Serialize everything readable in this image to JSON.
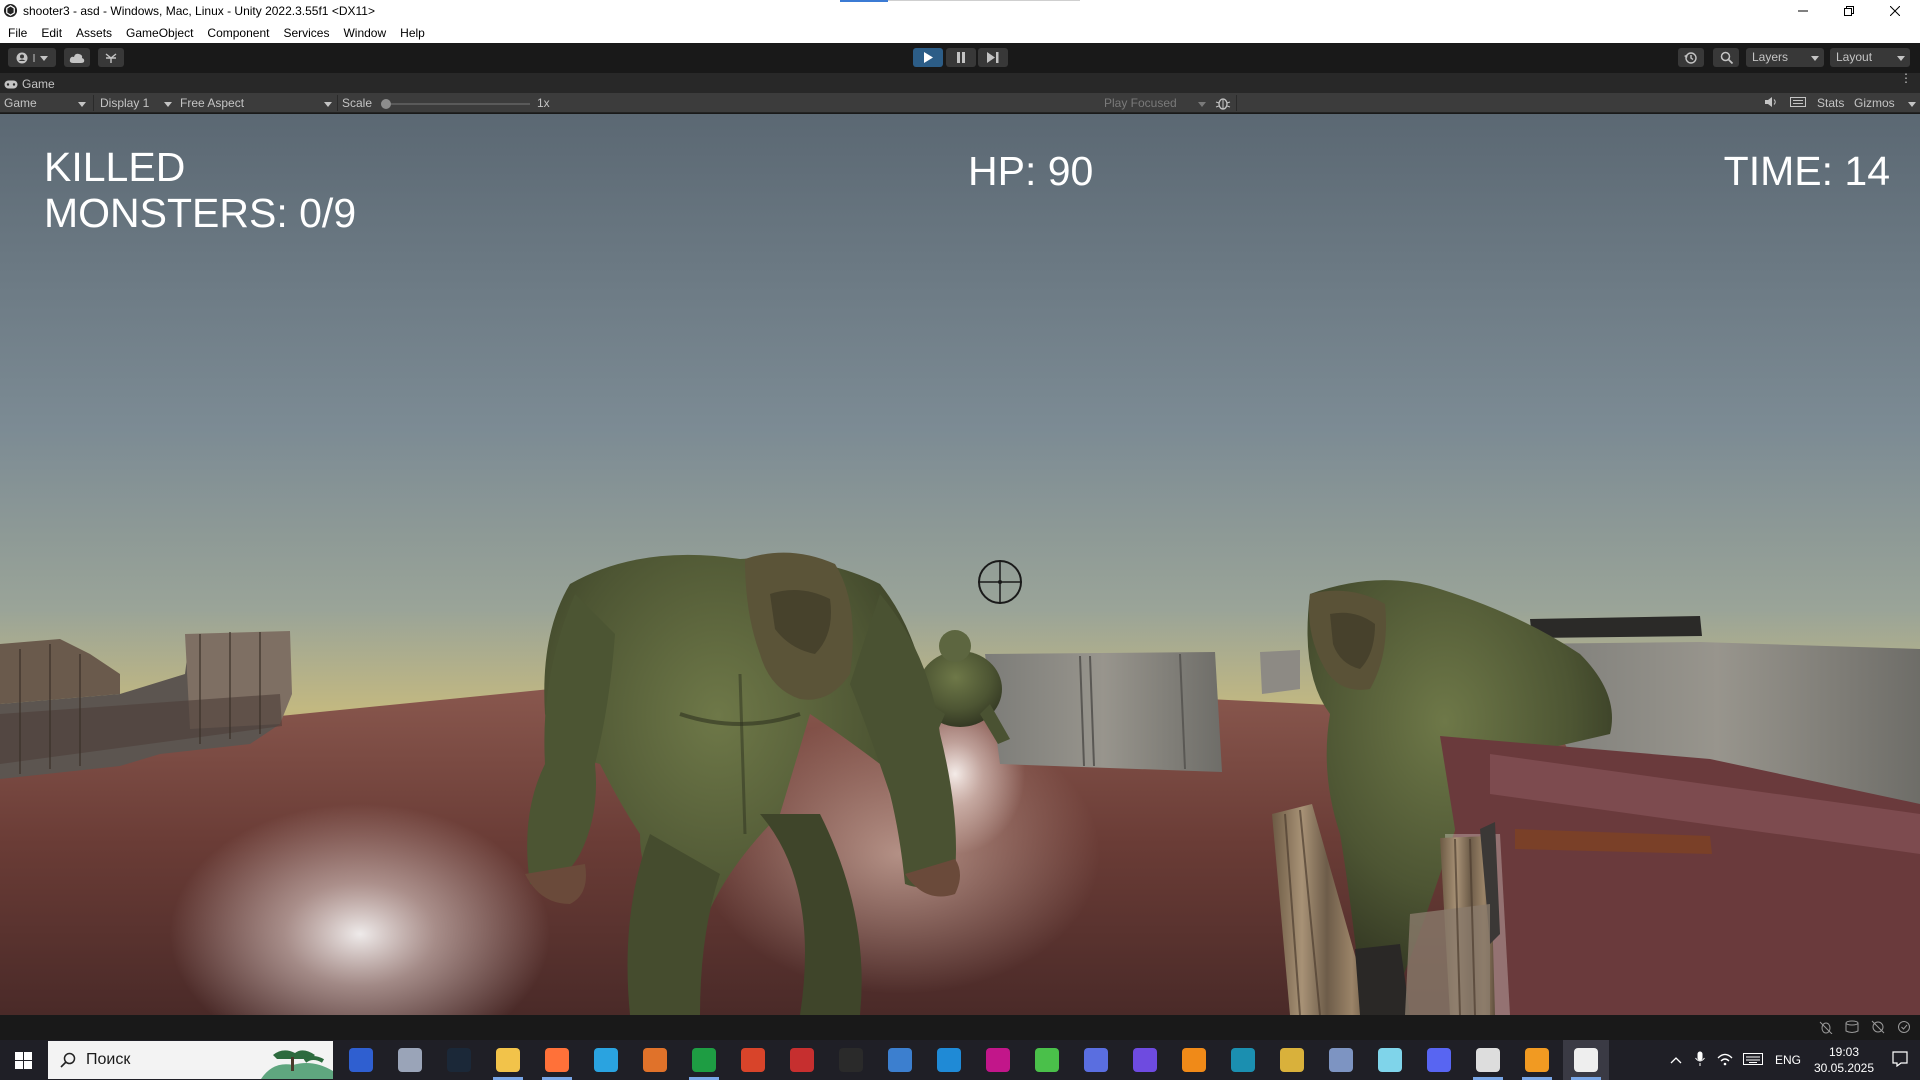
{
  "window": {
    "title": "shooter3 - asd - Windows, Mac, Linux - Unity 2022.3.55f1 <DX11>"
  },
  "menu": [
    "File",
    "Edit",
    "Assets",
    "GameObject",
    "Component",
    "Services",
    "Window",
    "Help"
  ],
  "toolbar": {
    "layers_label": "Layers",
    "layout_label": "Layout"
  },
  "tab": {
    "label": "Game"
  },
  "gamebar": {
    "view_mode": "Game",
    "display": "Display 1",
    "aspect": "Free Aspect",
    "scale_label": "Scale",
    "scale_value": "1x",
    "scale_fraction": 0.0,
    "play_focused": "Play Focused",
    "stats_label": "Stats",
    "gizmos_label": "Gizmos"
  },
  "hud": {
    "killed_line1": "KILLED",
    "killed_line2": "MONSTERS: 0/9",
    "hp": "HP: 90",
    "time": "TIME: 14"
  },
  "taskbar": {
    "search_placeholder": "Поиск",
    "apps": [
      {
        "name": "widget-app-icon",
        "color": "#2f5fd0"
      },
      {
        "name": "mail-app-icon",
        "color": "#9aa4b8"
      },
      {
        "name": "steam-icon",
        "color": "#1b2838"
      },
      {
        "name": "file-explorer-icon",
        "color": "#f2c34a"
      },
      {
        "name": "firefox-icon",
        "color": "#ff7139"
      },
      {
        "name": "telegram-icon",
        "color": "#2aa3e0"
      },
      {
        "name": "app-orange-stripes-icon",
        "color": "#e0722a"
      },
      {
        "name": "app-green-globe-icon",
        "color": "#1e9d43"
      },
      {
        "name": "app-red-circle-icon",
        "color": "#d8442a"
      },
      {
        "name": "app-red-archive-icon",
        "color": "#c62f2f"
      },
      {
        "name": "app-dark-circle-icon",
        "color": "#2a2a2a"
      },
      {
        "name": "app-dolphin-icon",
        "color": "#3c7fcf"
      },
      {
        "name": "app-blue-gear-icon",
        "color": "#1f8ad6"
      },
      {
        "name": "app-pink-icon",
        "color": "#c2168a"
      },
      {
        "name": "app-green-leaf-icon",
        "color": "#4ac04a"
      },
      {
        "name": "app-blue-diamond-icon",
        "color": "#5a6ee0"
      },
      {
        "name": "app-purple-chat-icon",
        "color": "#6e4be0"
      },
      {
        "name": "app-orange-fox-icon",
        "color": "#f08a18"
      },
      {
        "name": "app-teal-c-icon",
        "color": "#1b8fb0"
      },
      {
        "name": "app-yellow-cross-icon",
        "color": "#d9b13b"
      },
      {
        "name": "app-window-icon",
        "color": "#7d94c2"
      },
      {
        "name": "app-cyan-pen-icon",
        "color": "#7fd4ea"
      },
      {
        "name": "discord-icon",
        "color": "#5865f2"
      },
      {
        "name": "unity-hub-icon",
        "color": "#dddddd"
      },
      {
        "name": "sublime-text-icon",
        "color": "#f19a22"
      },
      {
        "name": "unity-editor-icon",
        "color": "#eeeeee"
      }
    ],
    "lang": "ENG",
    "time": "19:03",
    "date": "30.05.2025"
  }
}
